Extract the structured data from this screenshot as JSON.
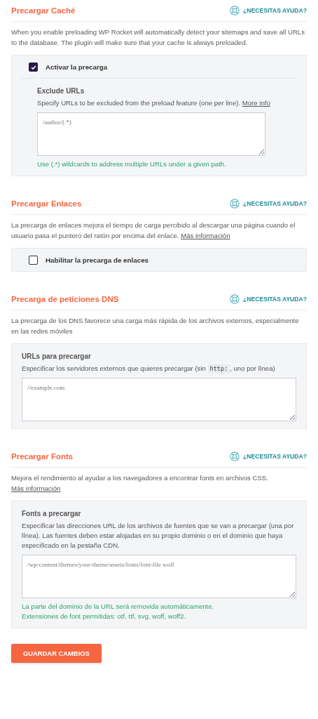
{
  "sections": [
    {
      "title": "Precargar Caché",
      "help": "¿NECESITAS AYUDA?",
      "description": {
        "text": "When you enable preloading WP Rocket will automatically detect your sitemaps and save all URLs to the database. The plugin will make sure that your cache is always preloaded."
      },
      "panel": {
        "checkbox": {
          "label": "Activar la precarga",
          "checked": true
        },
        "field": {
          "label": "Exclude URLs",
          "hint": {
            "text": "Specify URLs to be excluded from the preload feature (one per line).",
            "link": "More info"
          },
          "placeholder": "/author/(.*)",
          "notes": [
            "Use (.*) wildcards to address multiple URLs under a given path."
          ]
        }
      }
    },
    {
      "title": "Precargar Enlaces",
      "help": "¿NECESITAS AYUDA?",
      "description": {
        "text": "La precarga de enlaces mejora el tiempo de carga percibido al descargar una página cuando el usuario pasa el puntero del ratón por encima del enlace.",
        "link": "Más información"
      },
      "panel": {
        "checkbox": {
          "label": "Habilitar la precarga de enlaces",
          "checked": false
        }
      }
    },
    {
      "title": "Precarga de peticiones DNS",
      "help": "¿NECESITAS AYUDA?",
      "description": {
        "text": "La precarga de los DNS favorece una carga más rápida de los archivos externos, especialmente en las redes móviles"
      },
      "panel": {
        "field": {
          "label": "URLs para precargar",
          "hint": {
            "text": "Especificar los servidores externos que quieres precargar (sin",
            "code": "http:",
            "after": ", uno por línea)"
          },
          "placeholder": "//example.com"
        }
      }
    },
    {
      "title": "Precargar Fonts",
      "help": "¿NECESITAS AYUDA?",
      "description": {
        "text": "Mejora el rendimiento al ayudar a los navegadores a encontrar fonts en archivos CSS.",
        "link": "Más información"
      },
      "panel": {
        "field": {
          "label": "Fonts a precargar",
          "hint": {
            "text": "Especificar las direcciones URL de los archivos de fuentes que se van a precargar (una por línea). Las fuentes deben estar alojadas en su propio dominio o en el dominio que haya especificado en la pestaña CDN."
          },
          "placeholder": "/wp-content/themes/your-theme/assets/fonts/font-file.woff",
          "notes": [
            "La parte del dominio de la URL será removida automáticamente.",
            "Extensiones de font permitidas: otf, ttf, svg, woff, woff2."
          ]
        }
      }
    }
  ],
  "save_button": "GUARDAR CAMBIOS"
}
